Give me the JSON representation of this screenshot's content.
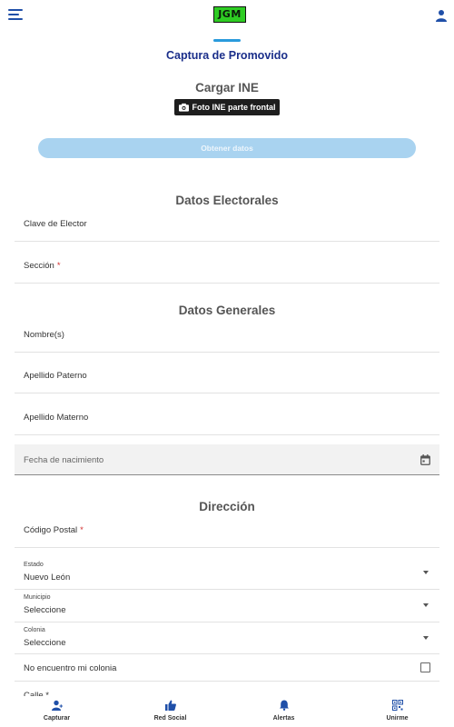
{
  "header": {
    "logo_text": "JGM",
    "menu_icon": "menu-icon",
    "user_icon": "user-icon"
  },
  "page": {
    "title": "Captura de Promovido"
  },
  "ine": {
    "title": "Cargar INE",
    "photo_button": "Foto INE parte frontal",
    "obtain_button": "Obtener datos"
  },
  "electorales": {
    "title": "Datos Electorales",
    "clave_label": "Clave de Elector",
    "seccion_label": "Sección",
    "required_mark": "*"
  },
  "generales": {
    "title": "Datos Generales",
    "nombre_label": "Nombre(s)",
    "paterno_label": "Apellido Paterno",
    "materno_label": "Apellido Materno",
    "nacimiento_placeholder": "Fecha de nacimiento"
  },
  "direccion": {
    "title": "Dirección",
    "cp_label": "Código Postal",
    "estado_label": "Estado",
    "estado_value": "Nuevo León",
    "municipio_label": "Municipio",
    "municipio_value": "Seleccione",
    "colonia_label": "Colonia",
    "colonia_value": "Seleccione",
    "no_colonia_label": "No encuentro mi colonia",
    "calle_label": "Calle *"
  },
  "nav": {
    "items": [
      {
        "label": "Capturar",
        "icon": "add-person-icon"
      },
      {
        "label": "Red Social",
        "icon": "thumbs-up-icon"
      },
      {
        "label": "Alertas",
        "icon": "bell-icon"
      },
      {
        "label": "Unirme",
        "icon": "qr-code-icon"
      }
    ]
  },
  "colors": {
    "accent": "#2a9bdc",
    "title_blue": "#1a2e8a",
    "nav_icon": "#1f4fa8",
    "logo_green": "#2ecc23"
  }
}
